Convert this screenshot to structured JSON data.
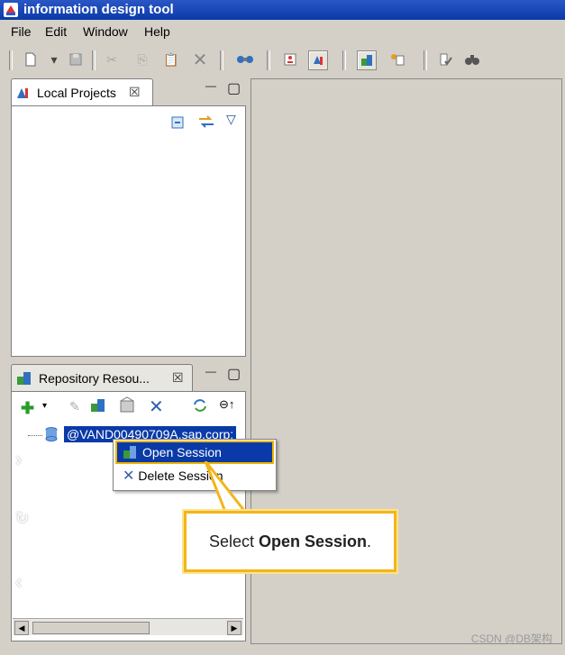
{
  "window": {
    "title": "information design tool"
  },
  "menubar": {
    "items": [
      "File",
      "Edit",
      "Window",
      "Help"
    ]
  },
  "toolbar": {
    "icons": [
      "new-file-icon",
      "dropdown-arrow-icon",
      "save-icon",
      "cut-icon",
      "copy-icon",
      "paste-icon",
      "delete-icon",
      "publish-icon",
      "project-icon",
      "idt-perspective-icon",
      "repository-icon",
      "security-icon",
      "check-integrity-icon",
      "find-icon"
    ]
  },
  "local_projects": {
    "tab_label": "Local Projects",
    "close_glyph": "☒",
    "min_glyph": "—",
    "max_glyph": "▢"
  },
  "repository": {
    "tab_label": "Repository Resou...",
    "close_glyph": "☒",
    "min_glyph": "—",
    "max_glyph": "▢",
    "session_node": "@VAND00490709A.sap.corp:"
  },
  "context_menu": {
    "items": [
      {
        "label": "Open Session",
        "active": true
      },
      {
        "label": "Delete Session",
        "active": false
      }
    ]
  },
  "callout": {
    "prefix": "Select",
    "bold": "Open Session",
    "suffix": "."
  },
  "watermark": "CSDN @DB架构"
}
